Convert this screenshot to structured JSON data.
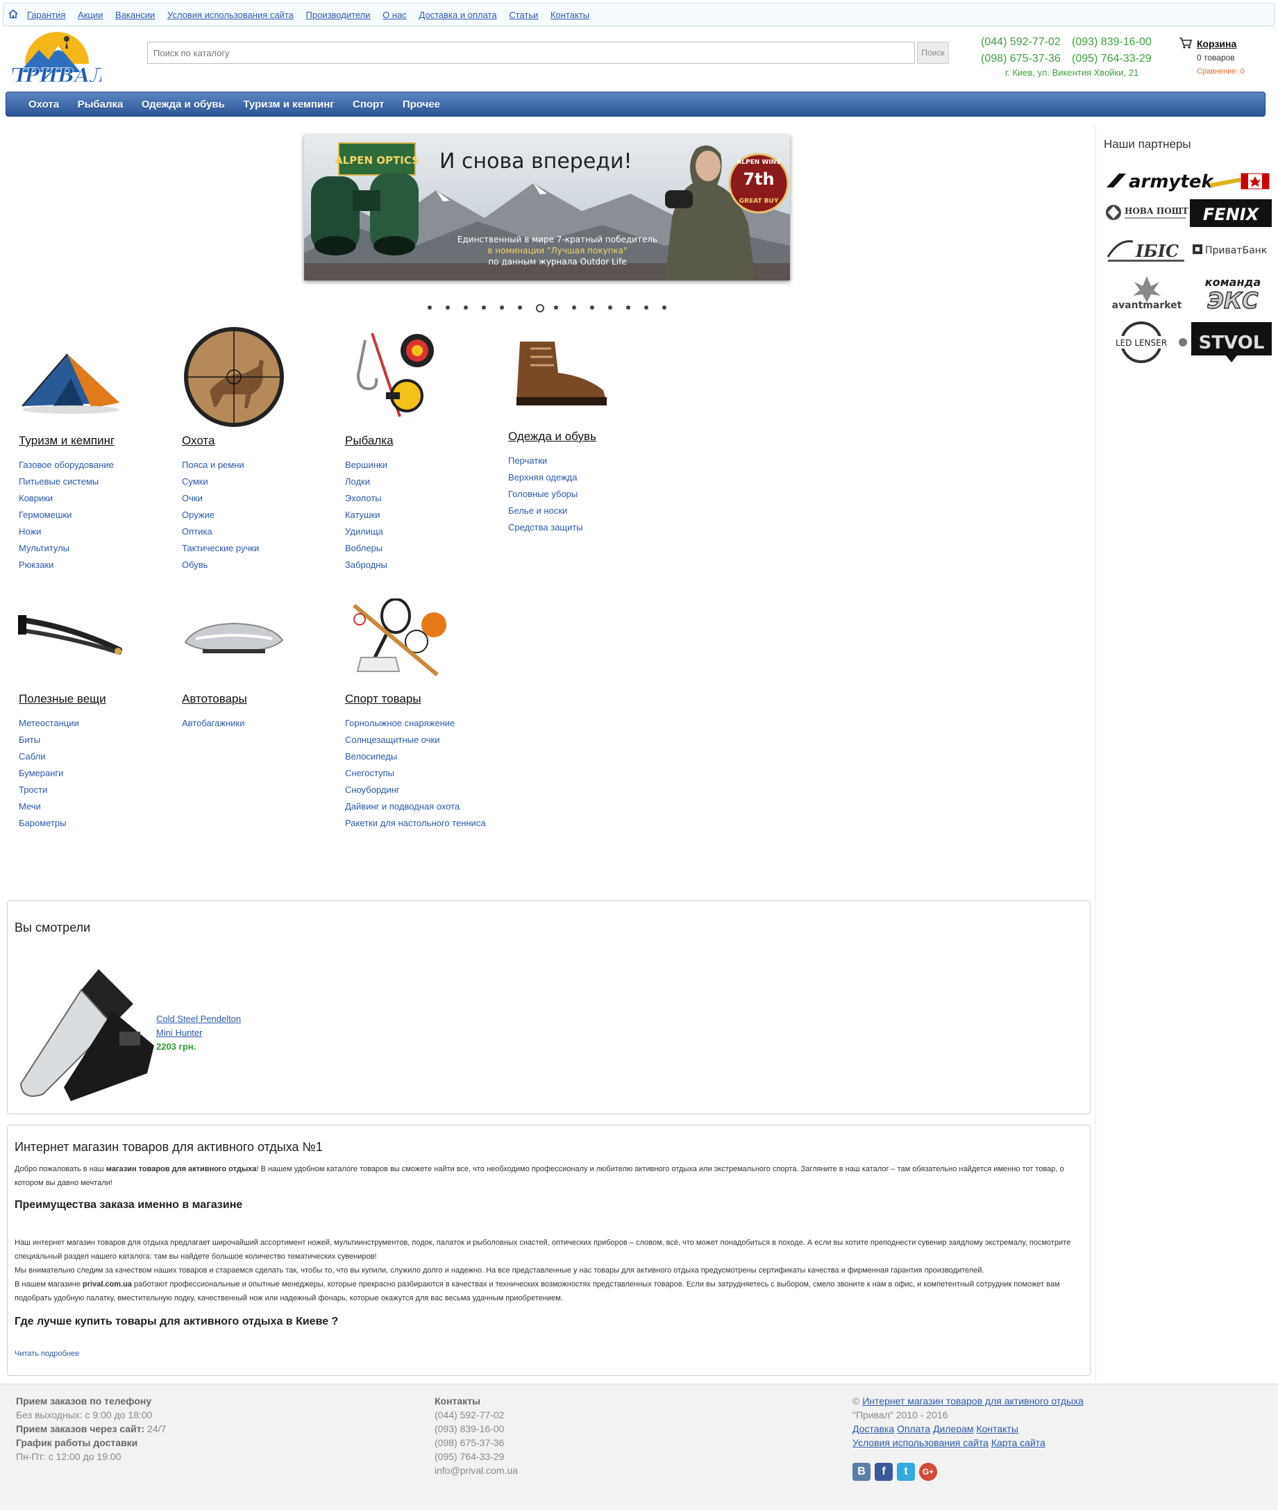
{
  "topnav": {
    "items": [
      "Гарантия",
      "Акции",
      "Вакансии",
      "Условия использования сайта",
      "Производители",
      "О нас",
      "Доставка и оплата",
      "Статьи",
      "Контакты"
    ]
  },
  "header": {
    "logo_text": "ПРИВАЛ",
    "search_placeholder": "Поиск по каталогу",
    "search_button": "Поиск",
    "phones": [
      "(044) 592-77-02",
      "(093) 839-16-00",
      "(098) 675-37-36",
      "(095) 764-33-29"
    ],
    "address": "г. Киев, ул. Викентия Хвойки, 21",
    "cart_label": "Корзина",
    "cart_count": "0 товаров",
    "compare": "Сравнение: 0"
  },
  "mainnav": {
    "items": [
      "Охота",
      "Рыбалка",
      "Одежда и обувь",
      "Туризм и кемпинг",
      "Спорт",
      "Прочее"
    ]
  },
  "banner": {
    "brand": "ALPEN OPTICS",
    "headline": "И снова впереди!",
    "line1": "Единственный в мире 7-кратный победитель",
    "line2": "в номинации \"Лучшая покупка\"",
    "line3": "по данным журнала Outdor Life",
    "badge_top": "ALPEN WINS",
    "badge_num": "7th",
    "badge_bottom": "GREAT BUY",
    "slide_count": 14,
    "active_slide": 6
  },
  "categories": [
    {
      "title": "Туризм и кемпинг",
      "items": [
        "Газовое оборудование",
        "Питьевые системы",
        "Коврики",
        "Гермомешки",
        "Ножи",
        "Мультитулы",
        "Рюкзаки"
      ]
    },
    {
      "title": "Охота",
      "items": [
        "Пояса и ремни",
        "Сумки",
        "Очки",
        "Оружие",
        "Оптика",
        "Тактические ручки",
        "Обувь"
      ]
    },
    {
      "title": "Рыбалка",
      "items": [
        "Вершинки",
        "Лодки",
        "Эхолоты",
        "Катушки",
        "Удилища",
        "Воблеры",
        "Забродны"
      ]
    },
    {
      "title": "Одежда и обувь",
      "items": [
        "Перчатки",
        "Верхняя одежда",
        "Головные уборы",
        "Белье и носки",
        "Средства защиты"
      ]
    },
    {
      "title": "Полезные вещи",
      "items": [
        "Метеостанции",
        "Биты",
        "Сабли",
        "Бумеранги",
        "Трости",
        "Мечи",
        "Барометры"
      ]
    },
    {
      "title": "Автотовары",
      "items": [
        "Автобагажники"
      ]
    },
    {
      "title": "Спорт товары",
      "items": [
        "Горнолыжное снаряжение",
        "Солнцезащитные очки",
        "Велосипеды",
        "Снегоступы",
        "Сноубординг",
        "Дайвинг и подводная охота",
        "Ракетки для настольного тенниса"
      ]
    }
  ],
  "partners": {
    "title": "Наши партнеры",
    "logos": [
      "armytek",
      "НОВА ПОШТА",
      "FENIX",
      "ІБІС",
      "ПриватБанк",
      "avantmarket",
      "команда ЭКС",
      "LED LENSER",
      "STVOL"
    ]
  },
  "viewed": {
    "title": "Вы смотрели",
    "product_line1": "Cold Steel Pendelton",
    "product_line2": "Mini Hunter",
    "price": "2203 грн."
  },
  "about": {
    "h1": "Интернет магазин товаров для активного отдыха №1",
    "p1_a": "Добро пожаловать в наш ",
    "p1_b": "магазин товаров для активного отдыха",
    "p1_c": "! В нашем удобном каталоге товаров вы сможете найти все, что необходимо профессионалу и любителю активного отдыха или экстремального спорта. Загляните в наш каталог – там обязательно найдется именно тот товар, о котором вы давно мечтали!",
    "h2a": "Преимущества заказа именно в магазине",
    "p2": "Наш интернет магазин товаров для отдыха предлагает широчайший ассортимент ножей, мультиинструментов, подок, палаток и рыболовных снастей, оптических приборов – словом, всё, что может понадобиться в походе. А если вы хотите преподнести сувенир заядлому экстремалу, посмотрите специальный раздел нашего каталога: там вы найдете большое количество тематических сувениров!",
    "p3": "Мы внимательно следим за качеством наших товаров и стараемся сделать так, чтобы то, что вы купили, служило долго и надежно. На все представленные у нас товары для активного отдыха предусмотрены сертификаты качества и фирменная гарантия производителей.",
    "p4_a": "В нашем магазине ",
    "p4_b": "prival.com.ua",
    "p4_c": " работают профессиональные и опытные менеджеры, которые прекрасно разбираются в качествах и технических возможностях представленных товаров. Если вы затрудняетесь с выбором, смело звоните к нам в офис, и компетентный сотрудник поможет вам подобрать удобную палатку, вместительную подку, качественный нож или надежный фонарь, которые окажутся для вас весьма удачным приобретением.",
    "h2b": "Где лучше купить товары для активного отдыха в Киеве ?",
    "readmore": "Читать подробнее"
  },
  "footer": {
    "col1": {
      "t1": "Прием заказов по телефону",
      "l1": "Без выходных: с 9:00 до 18:00",
      "t2": "Прием заказов через сайт:",
      "l2": " 24/7",
      "t3": "График работы доставки",
      "l3": "Пн-Пт: с 12:00 до 19:00"
    },
    "col2": {
      "title": "Контакты",
      "phones": [
        "(044) 592-77-02",
        "(093) 839-16-00",
        "(098) 675-37-36",
        "(095) 764-33-29"
      ],
      "email": "info@prival.com.ua"
    },
    "col3": {
      "copy": "© ",
      "copy_link": "Интернет магазин товаров для активного отдыха",
      "years": "\"Привал\" 2010 - 2016",
      "links1": [
        "Доставка",
        "Оплата",
        "Дилерам",
        "Контакты"
      ],
      "links2": [
        "Условия использования сайта",
        "Карта сайта"
      ]
    },
    "social": [
      "В",
      "f",
      "t",
      "G+"
    ]
  }
}
